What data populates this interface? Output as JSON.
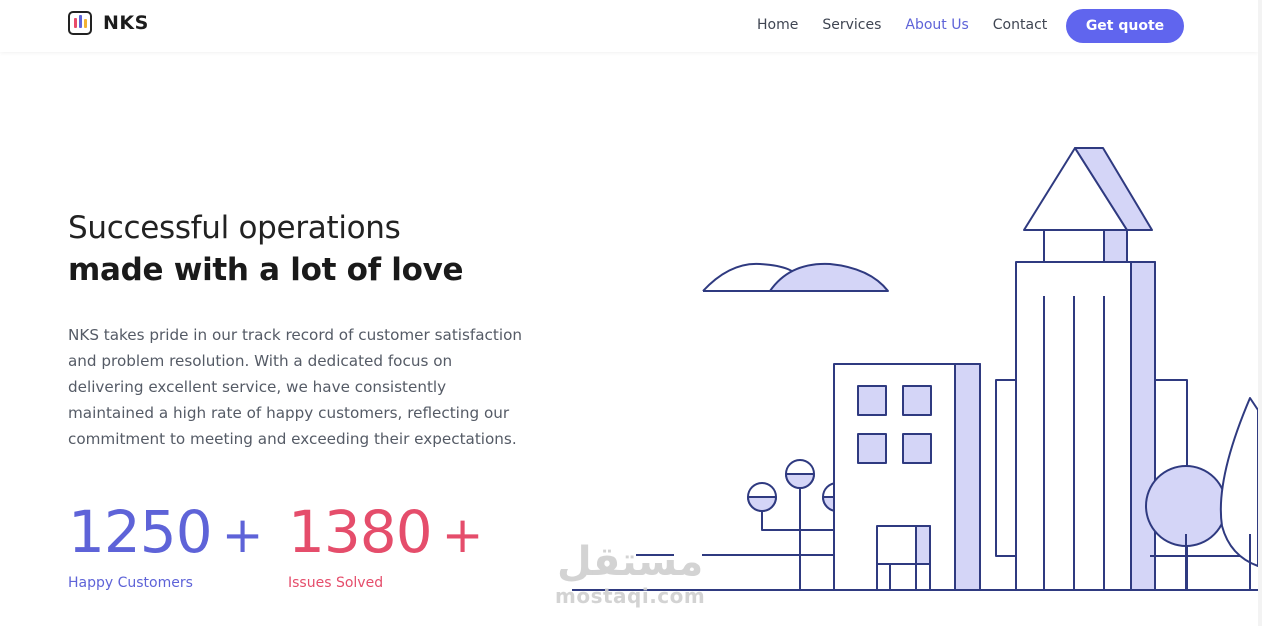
{
  "brand": {
    "name": "NKS",
    "logo_colors": [
      "#e94b6a",
      "#5e63d8",
      "#f2b233"
    ]
  },
  "nav": {
    "items": [
      {
        "label": "Home",
        "active": false
      },
      {
        "label": "Services",
        "active": false
      },
      {
        "label": "About Us",
        "active": true
      },
      {
        "label": "Contact",
        "active": false
      }
    ],
    "cta_label": "Get quote"
  },
  "hero": {
    "title_line1": "Successful operations",
    "title_line2": "made with a lot of love",
    "description": "NKS takes pride in our track record of customer satisfaction and problem resolution. With a dedicated focus on delivering excellent service, we have consistently maintained a high rate of happy customers, reflecting our commitment to meeting and exceeding their expectations."
  },
  "stats": [
    {
      "value": "1250",
      "suffix": "+",
      "label": "Happy Customers",
      "color": "#5e63d8"
    },
    {
      "value": "1380",
      "suffix": "+",
      "label": "Issues Solved",
      "color": "#e54d6b"
    }
  ],
  "illustration": {
    "name": "city-buildings-illustration",
    "stroke": "#2f3a80",
    "fill": "#d4d5f7"
  },
  "watermark": {
    "arabic": "مستقل",
    "latin": "mostaqi.com"
  },
  "colors": {
    "accent": "#6065ee",
    "secondary": "#e54d6b"
  }
}
